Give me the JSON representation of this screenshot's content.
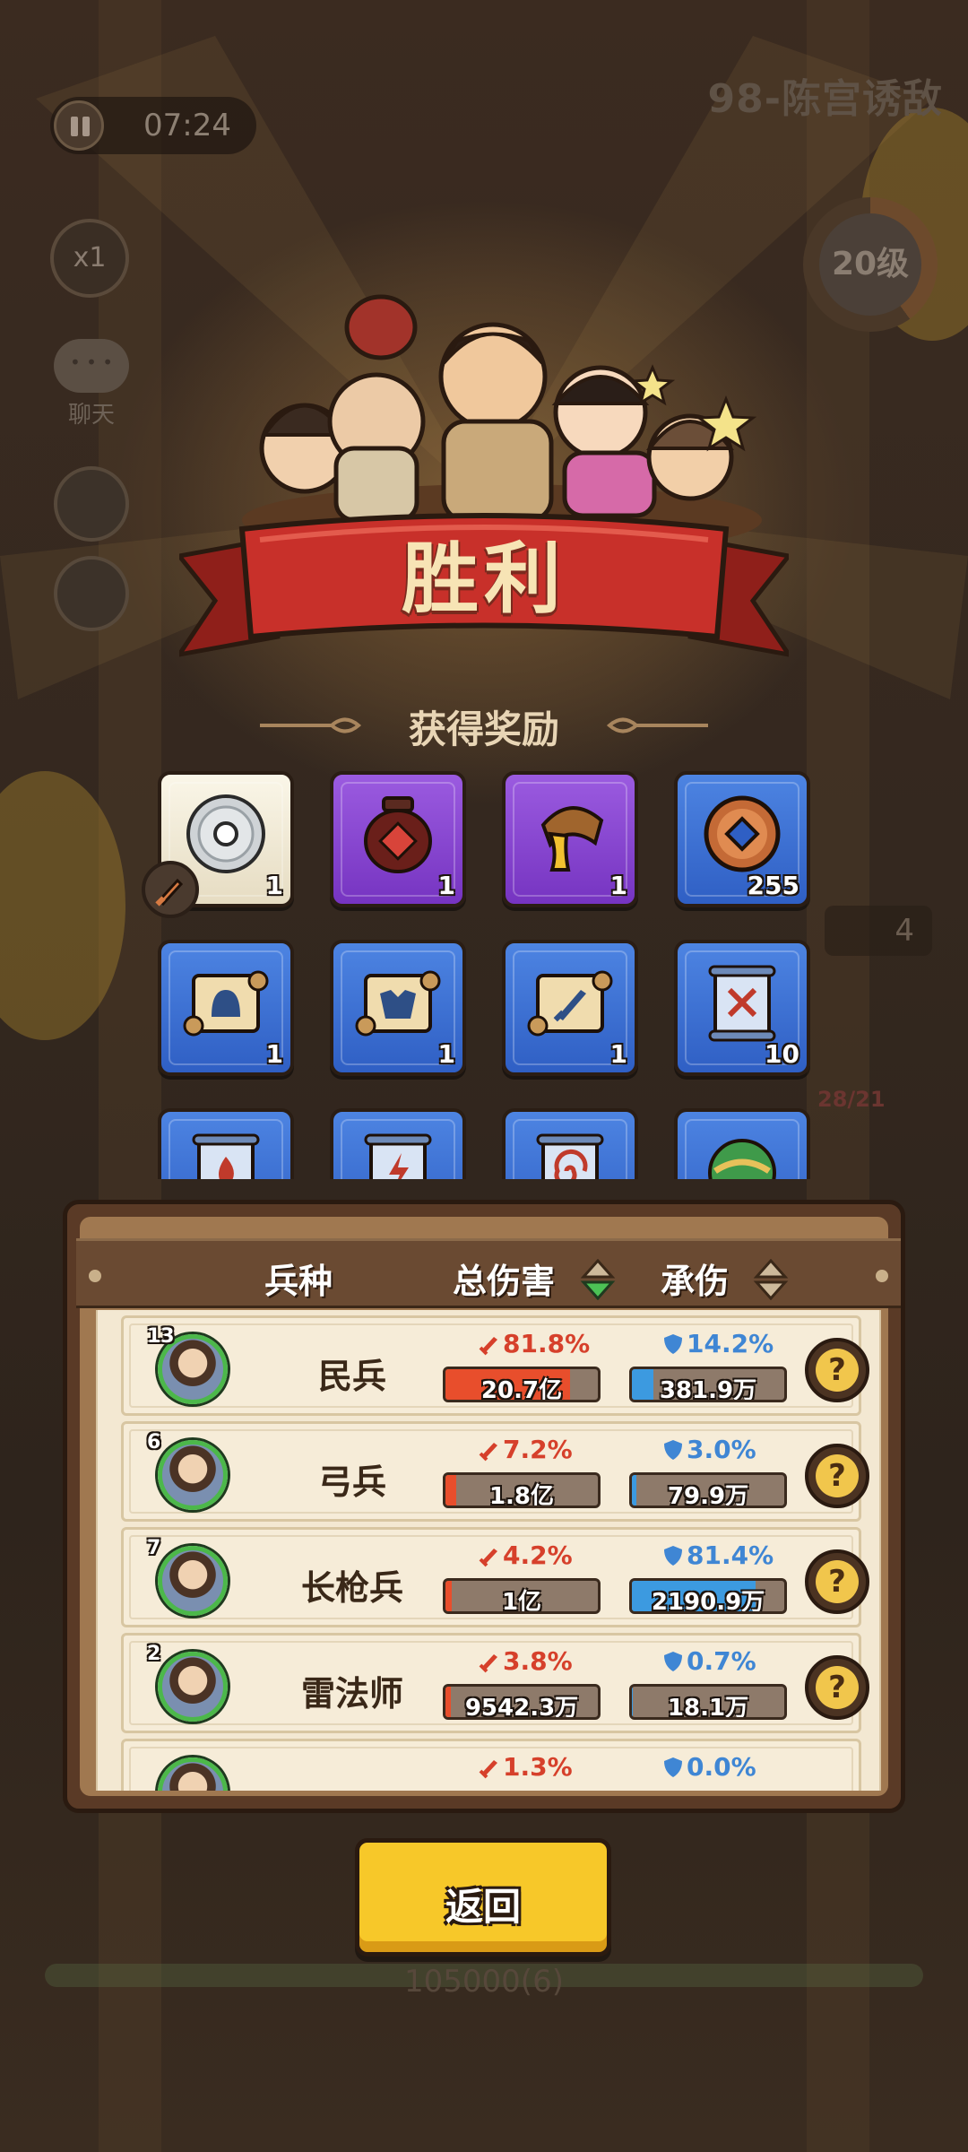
{
  "hud": {
    "timer": "07:24",
    "stage_title": "98-陈宫诱敌",
    "speed": "x1",
    "chat_label": "聊天",
    "level": "20级",
    "side_count": "4",
    "side_troops": "28/21",
    "bottom_score": "105000(6)"
  },
  "victory": {
    "title": "胜利",
    "rewards_title": "获得奖励"
  },
  "rewards": [
    {
      "name": "silver-disc",
      "rarity": "white",
      "count": "1"
    },
    {
      "name": "wine-jar",
      "rarity": "purple",
      "count": "1"
    },
    {
      "name": "golden-horn",
      "rarity": "purple",
      "count": "1"
    },
    {
      "name": "copper-coin",
      "rarity": "blue",
      "count": "255"
    },
    {
      "name": "scroll-helmet",
      "rarity": "blue",
      "count": "1"
    },
    {
      "name": "scroll-armor",
      "rarity": "blue",
      "count": "1"
    },
    {
      "name": "scroll-sword",
      "rarity": "blue",
      "count": "1"
    },
    {
      "name": "scroll-crossed",
      "rarity": "blue",
      "count": "10"
    },
    {
      "name": "scroll-fire",
      "rarity": "blue",
      "count": ""
    },
    {
      "name": "scroll-lightning",
      "rarity": "blue",
      "count": ""
    },
    {
      "name": "scroll-spiral",
      "rarity": "blue",
      "count": ""
    },
    {
      "name": "green-orb",
      "rarity": "blue",
      "count": ""
    }
  ],
  "stats": {
    "header": {
      "unit": "兵种",
      "damage": "总伤害",
      "taken": "承伤"
    },
    "rows": [
      {
        "level": "13",
        "name": "民兵",
        "damage_pct": "81.8%",
        "damage_value": "20.7亿",
        "damage_fill": 0.818,
        "taken_pct": "14.2%",
        "taken_value": "381.9万",
        "taken_fill": 0.142
      },
      {
        "level": "6",
        "name": "弓兵",
        "damage_pct": "7.2%",
        "damage_value": "1.8亿",
        "damage_fill": 0.072,
        "taken_pct": "3.0%",
        "taken_value": "79.9万",
        "taken_fill": 0.03
      },
      {
        "level": "7",
        "name": "长枪兵",
        "damage_pct": "4.2%",
        "damage_value": "1亿",
        "damage_fill": 0.042,
        "taken_pct": "81.4%",
        "taken_value": "2190.9万",
        "taken_fill": 0.814
      },
      {
        "level": "2",
        "name": "雷法师",
        "damage_pct": "3.8%",
        "damage_value": "9542.3万",
        "damage_fill": 0.038,
        "taken_pct": "0.7%",
        "taken_value": "18.1万",
        "taken_fill": 0.007
      },
      {
        "level": "",
        "name": "",
        "damage_pct": "1.3%",
        "damage_value": "",
        "damage_fill": 0.013,
        "taken_pct": "0.0%",
        "taken_value": "",
        "taken_fill": 0.0
      }
    ],
    "help_symbol": "?"
  },
  "return_button": "返回",
  "colors": {
    "damage": "#d6402b",
    "taken": "#3f86d4",
    "button": "#f7c829",
    "banner": "#c8302a"
  }
}
